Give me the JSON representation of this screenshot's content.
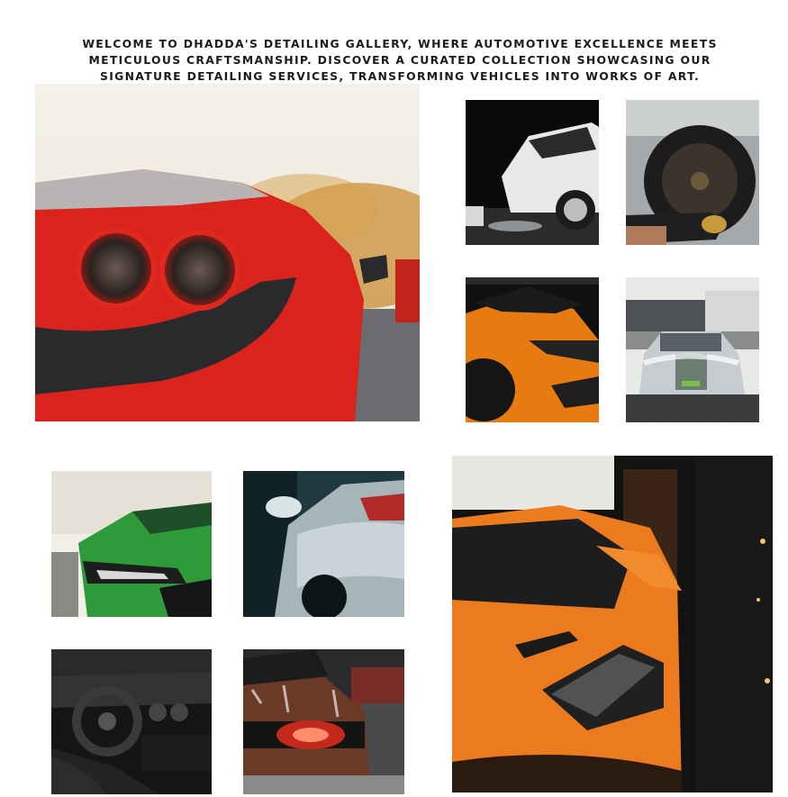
{
  "gallery": {
    "intro": "WELCOME TO DHADDA'S DETAILING GALLERY, WHERE AUTOMOTIVE EXCELLENCE MEETS METICULOUS CRAFTSMANSHIP. DISCOVER A CURATED COLLECTION SHOWCASING OUR SIGNATURE DETAILING SERVICES, TRANSFORMING VEHICLES INTO WORKS OF ART.",
    "photos": [
      {
        "subject": "red-sports-car-taillights"
      },
      {
        "subject": "white-car-foam-wash"
      },
      {
        "subject": "wheel-cleaning-gloved-hand"
      },
      {
        "subject": "orange-supercar-front"
      },
      {
        "subject": "foamed-muscle-car-garage"
      },
      {
        "subject": "green-car-headlight-wet"
      },
      {
        "subject": "foam-covered-car-rear"
      },
      {
        "subject": "orange-mclaren-dark-garage"
      },
      {
        "subject": "luxury-car-interior-steering"
      },
      {
        "subject": "copper-car-taillight-soap"
      }
    ]
  }
}
